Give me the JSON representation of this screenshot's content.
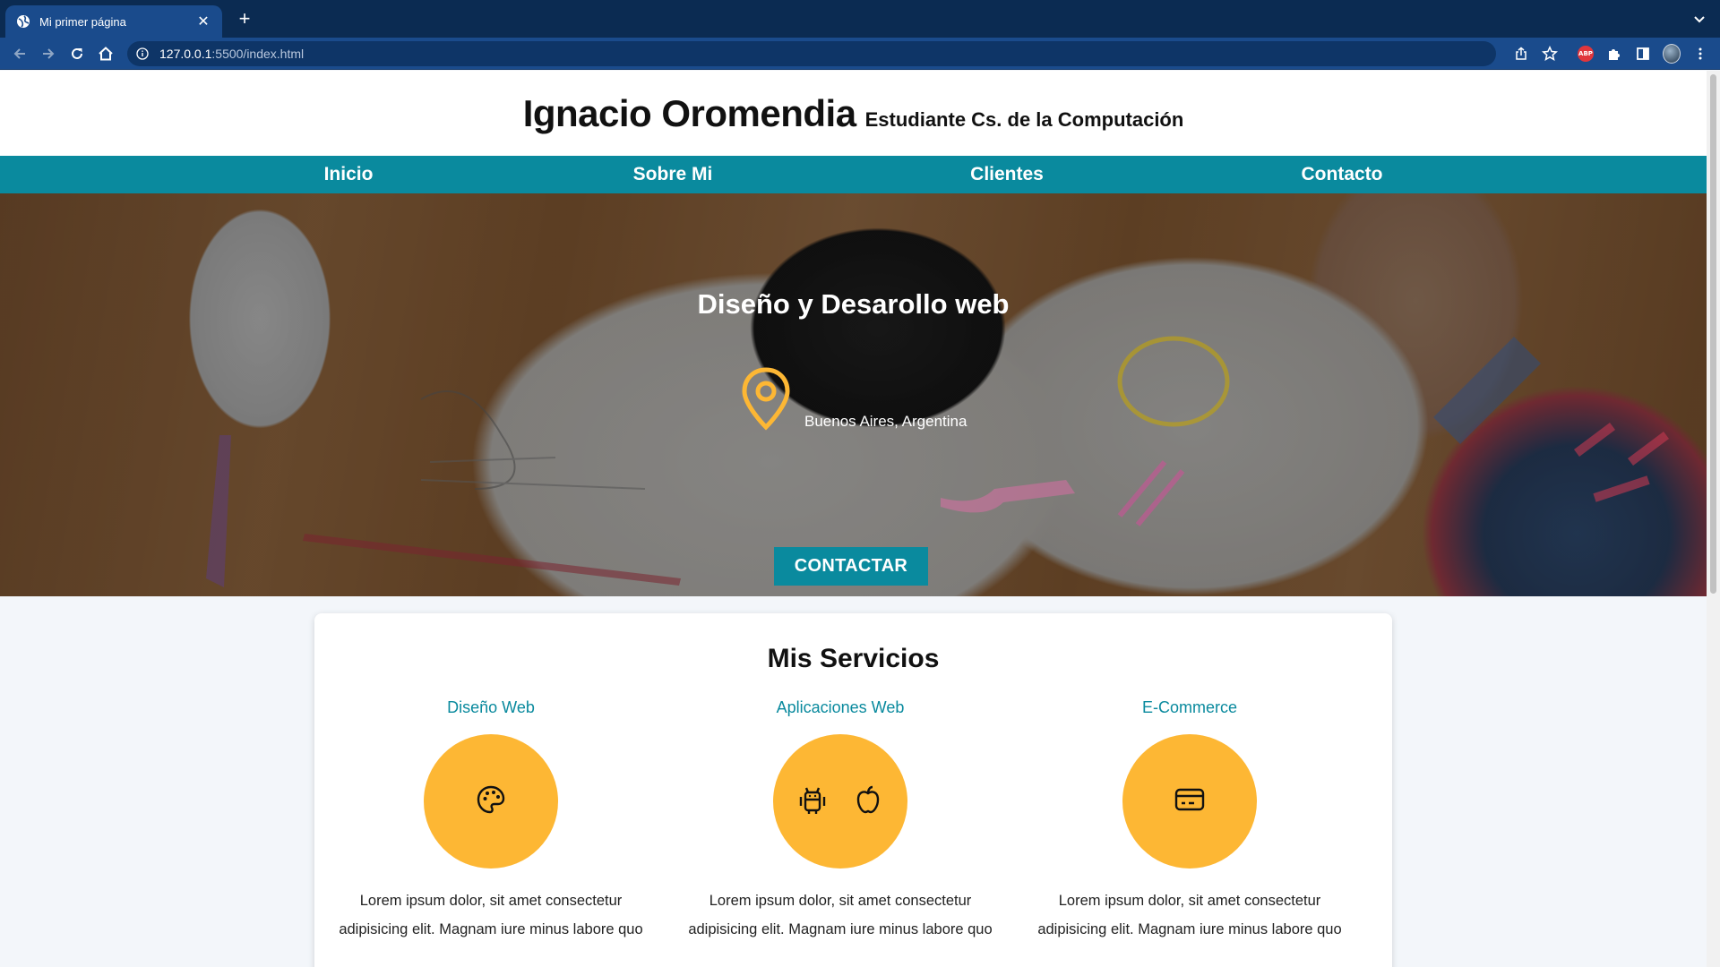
{
  "browser": {
    "tab_title": "Mi primer página",
    "tab_close": "✕",
    "new_tab": "+",
    "url_host": "127.0.0.1",
    "url_path": ":5500/index.html",
    "abp_label": "ABP"
  },
  "site": {
    "header": {
      "name": "Ignacio Oromendia",
      "subtitle": "Estudiante Cs. de la Computación"
    },
    "nav": [
      "Inicio",
      "Sobre Mi",
      "Clientes",
      "Contacto"
    ],
    "hero": {
      "title": "Diseño y Desarollo web",
      "location": "Buenos Aires, Argentina",
      "cta": "CONTACTAR"
    },
    "services": {
      "title": "Mis Servicios",
      "items": [
        {
          "name": "Diseño Web",
          "icons": [
            "palette-icon"
          ],
          "description": "Lorem ipsum dolor, sit amet consectetur adipisicing elit. Magnam iure minus labore quo"
        },
        {
          "name": "Aplicaciones Web",
          "icons": [
            "android-icon",
            "apple-icon"
          ],
          "description": "Lorem ipsum dolor, sit amet consectetur adipisicing elit. Magnam iure minus labore quo"
        },
        {
          "name": "E-Commerce",
          "icons": [
            "credit-card-icon"
          ],
          "description": "Lorem ipsum dolor, sit amet consectetur adipisicing elit. Magnam iure minus labore quo"
        }
      ]
    }
  },
  "colors": {
    "browser_dark": "#0b2b52",
    "browser_toolbar": "#1a4b8c",
    "accent_teal": "#0a8a9e",
    "accent_yellow": "#fdb734"
  }
}
